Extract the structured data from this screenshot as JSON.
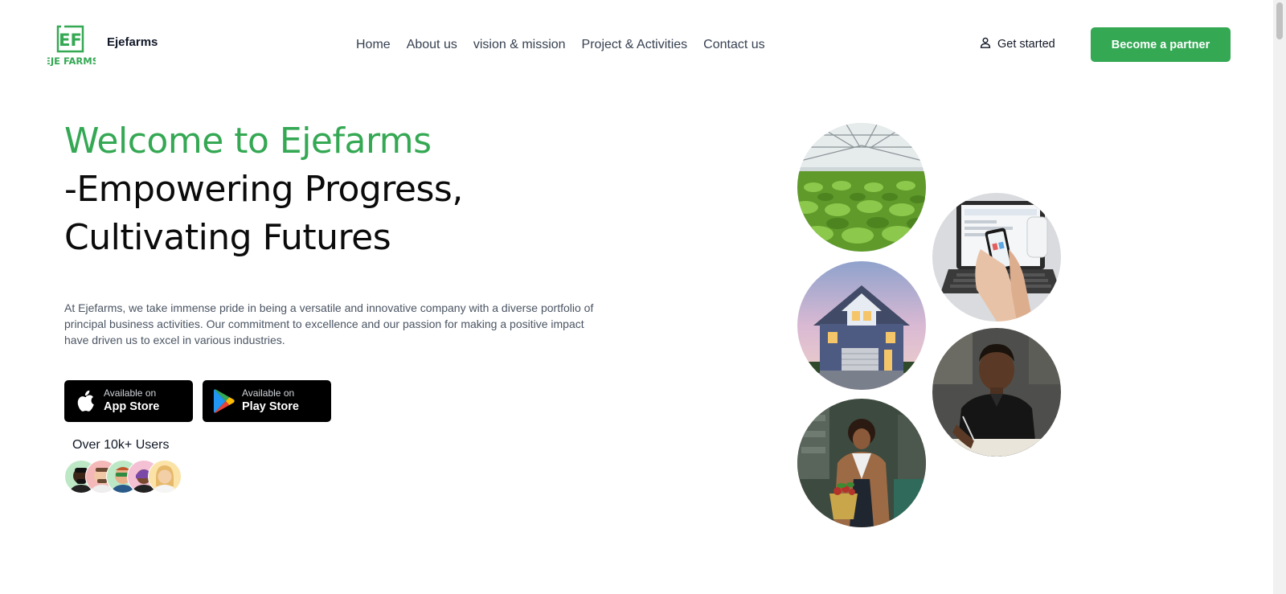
{
  "brand": {
    "logo_letters": "EF",
    "logo_caption": "EJE FARMS",
    "name": "Ejefarms"
  },
  "nav": {
    "items": [
      {
        "label": "Home"
      },
      {
        "label": "About us"
      },
      {
        "label": "vision & mission"
      },
      {
        "label": "Project & Activities"
      },
      {
        "label": "Contact us"
      }
    ]
  },
  "header": {
    "get_started_label": "Get started",
    "get_started_icon": "user-icon",
    "partner_label": "Become a partner"
  },
  "hero": {
    "title_line1": "Welcome to Ejefarms",
    "title_line2": "-Empowering Progress,",
    "title_line3": "Cultivating Futures",
    "description": "At Ejefarms, we take immense pride in being a versatile and innovative company with a diverse portfolio of principal business activities. Our commitment to excellence and our passion for making a positive impact have driven us to excel in various industries."
  },
  "stores": {
    "app": {
      "small": "Available on",
      "big": "App Store",
      "icon": "apple-icon"
    },
    "play": {
      "small": "Available on",
      "big": "Play Store",
      "icon": "google-play-icon"
    }
  },
  "users": {
    "label": "Over 10k+ Users"
  },
  "colors": {
    "accent": "#34a853",
    "dark": "#0b0b0b",
    "store_bg": "#000000"
  }
}
